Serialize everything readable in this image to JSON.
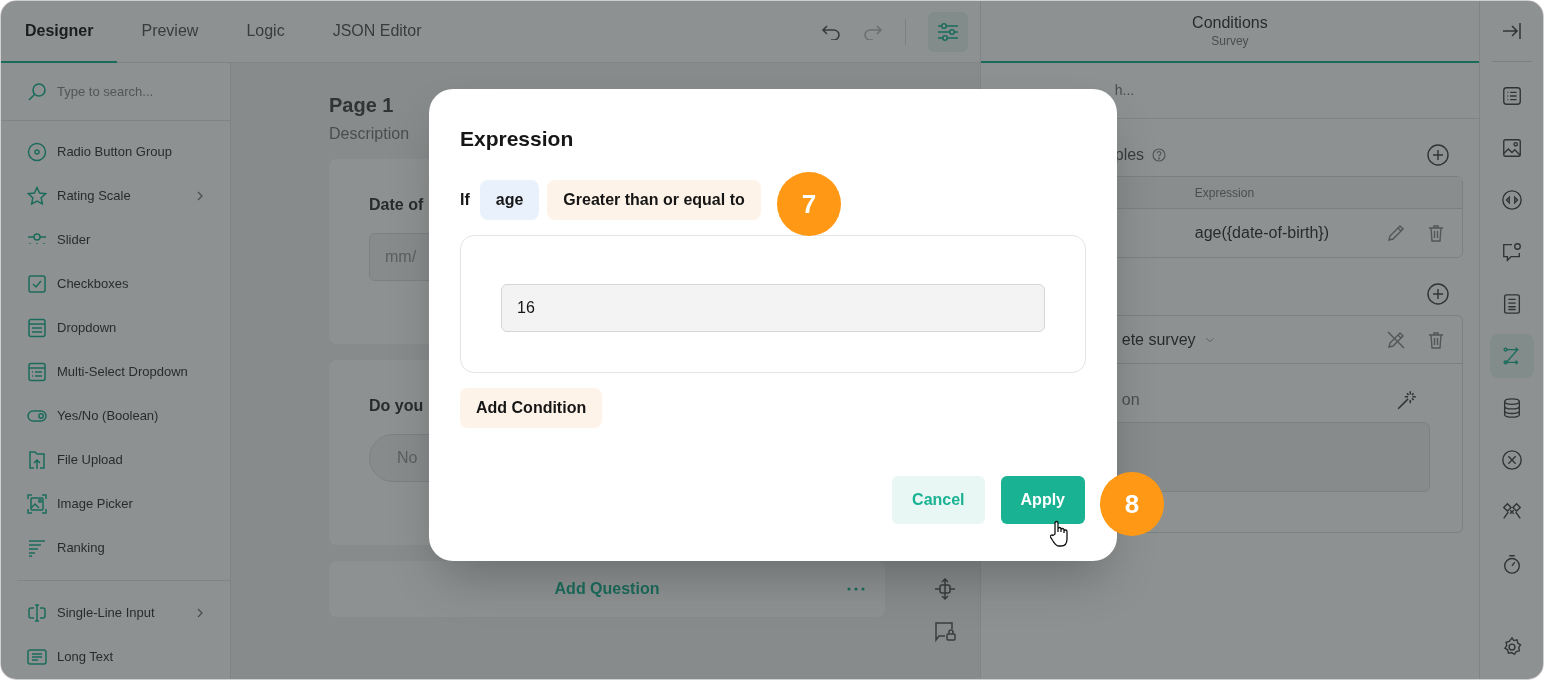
{
  "tabs": [
    {
      "label": "Designer",
      "selected": true
    },
    {
      "label": "Preview",
      "selected": false
    },
    {
      "label": "Logic",
      "selected": false
    },
    {
      "label": "JSON Editor",
      "selected": false
    }
  ],
  "toolbox": {
    "search_placeholder": "Type to search...",
    "groups": [
      [
        {
          "label": "Radio Button Group",
          "kind": "radio",
          "has_submenu": false
        },
        {
          "label": "Rating Scale",
          "kind": "star",
          "has_submenu": true
        },
        {
          "label": "Slider",
          "kind": "slider",
          "has_submenu": false
        },
        {
          "label": "Checkboxes",
          "kind": "checkbox",
          "has_submenu": false
        },
        {
          "label": "Dropdown",
          "kind": "dropdown",
          "has_submenu": false
        },
        {
          "label": "Multi-Select Dropdown",
          "kind": "multidropdown",
          "has_submenu": false
        },
        {
          "label": "Yes/No (Boolean)",
          "kind": "toggle",
          "has_submenu": false
        },
        {
          "label": "File Upload",
          "kind": "upload",
          "has_submenu": false
        },
        {
          "label": "Image Picker",
          "kind": "image",
          "has_submenu": false
        },
        {
          "label": "Ranking",
          "kind": "ranking",
          "has_submenu": false
        }
      ],
      [
        {
          "label": "Single-Line Input",
          "kind": "textinput",
          "has_submenu": true
        },
        {
          "label": "Long Text",
          "kind": "longtext",
          "has_submenu": false
        }
      ]
    ]
  },
  "canvas": {
    "page_title": "Page 1",
    "page_description": "Description",
    "questions": [
      {
        "kind": "date",
        "title": "Date of",
        "placeholder": "mm/"
      },
      {
        "kind": "boolean",
        "title": "Do you",
        "option": "No"
      }
    ],
    "add_question": "Add Question"
  },
  "property_panel": {
    "title": "Conditions",
    "subtitle": "Survey",
    "search_placeholder": "h...",
    "variables": {
      "label": "ples",
      "column": "Expression",
      "rows": [
        {
          "expression": "age({date-of-birth})"
        }
      ]
    },
    "triggers": [
      {
        "label": "ete survey",
        "condition_label": "on"
      }
    ]
  },
  "side_tabs": [
    {
      "kind": "list",
      "selected": false
    },
    {
      "kind": "image",
      "selected": false
    },
    {
      "kind": "code",
      "selected": false
    },
    {
      "kind": "chatgear",
      "selected": false
    },
    {
      "kind": "doc",
      "selected": false
    },
    {
      "kind": "logic",
      "selected": true
    },
    {
      "kind": "database",
      "selected": false
    },
    {
      "kind": "xcircle",
      "selected": false
    },
    {
      "kind": "translate",
      "selected": false
    },
    {
      "kind": "timer",
      "selected": false
    }
  ],
  "dialog": {
    "title": "Expression",
    "if_label": "If",
    "operand": "age",
    "operator": "Greater than or equal to",
    "value": "16",
    "add_condition": "Add Condition",
    "buttons": [
      {
        "label": "Cancel",
        "kind": "secondary"
      },
      {
        "label": "Apply",
        "kind": "primary"
      }
    ]
  },
  "callouts": [
    "7",
    "8"
  ]
}
